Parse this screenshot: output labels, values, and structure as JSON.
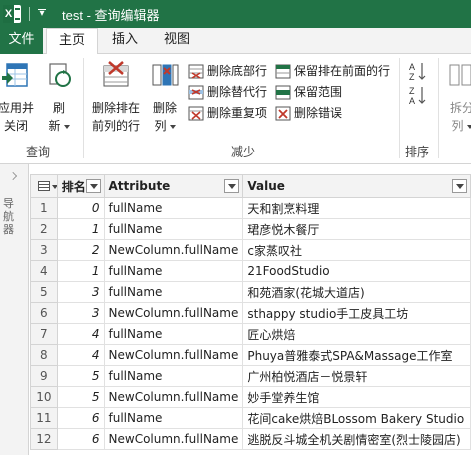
{
  "window": {
    "title": "test - 查询编辑器",
    "app_icon_letter": "X"
  },
  "tabs": [
    {
      "label": "文件",
      "active": false
    },
    {
      "label": "主页",
      "active": true
    },
    {
      "label": "插入",
      "active": false
    },
    {
      "label": "视图",
      "active": false
    }
  ],
  "ribbon": {
    "query_group": {
      "label": "查询",
      "apply_close": [
        "应用并",
        "关闭"
      ],
      "refresh": [
        "刷",
        "新"
      ]
    },
    "reduce_group": {
      "label": "减少",
      "remove_top_rows": [
        "删除排在",
        "前列的行"
      ],
      "remove_columns": [
        "删除",
        "列"
      ],
      "remove_bottom_rows": "删除底部行",
      "remove_alternate_rows": "删除替代行",
      "remove_duplicates": "删除重复项",
      "keep_top_rows": "保留排在前面的行",
      "keep_range": "保留范围",
      "remove_errors": "删除错误"
    },
    "sort_group": {
      "label": "排序"
    },
    "split_group": {
      "split_column": [
        "拆分",
        "列"
      ]
    }
  },
  "navigator": {
    "label": "导航器"
  },
  "colors": {
    "accent": "#217346",
    "title_text": "#ffffff",
    "accent_red": "#c0392b",
    "accent_blue": "#2e75b6"
  },
  "table": {
    "columns": [
      "排名",
      "Attribute",
      "Value"
    ],
    "rows": [
      {
        "n": "1",
        "rank": "0",
        "attr": "fullName",
        "value": "天和割烹料理"
      },
      {
        "n": "2",
        "rank": "1",
        "attr": "fullName",
        "value": "珺彦悦木餐厅"
      },
      {
        "n": "3",
        "rank": "2",
        "attr": "NewColumn.fullName",
        "value": "c家蒸叹社"
      },
      {
        "n": "4",
        "rank": "1",
        "attr": "fullName",
        "value": "21FoodStudio"
      },
      {
        "n": "5",
        "rank": "3",
        "attr": "fullName",
        "value": "和苑酒家(花城大道店)"
      },
      {
        "n": "6",
        "rank": "3",
        "attr": "NewColumn.fullName",
        "value": "sthappy studio手工皮具工坊"
      },
      {
        "n": "7",
        "rank": "4",
        "attr": "fullName",
        "value": "匠心烘焙"
      },
      {
        "n": "8",
        "rank": "4",
        "attr": "NewColumn.fullName",
        "value": "Phuya普雅泰式SPA&Massage工作室"
      },
      {
        "n": "9",
        "rank": "5",
        "attr": "fullName",
        "value": "广州柏悦酒店－悦景轩"
      },
      {
        "n": "10",
        "rank": "5",
        "attr": "NewColumn.fullName",
        "value": "妙手堂养生馆"
      },
      {
        "n": "11",
        "rank": "6",
        "attr": "fullName",
        "value": "花间cake烘焙BLossom Bakery Studio"
      },
      {
        "n": "12",
        "rank": "6",
        "attr": "NewColumn.fullName",
        "value": "逃脱反斗城全机关剧情密室(烈士陵园店)"
      }
    ]
  }
}
